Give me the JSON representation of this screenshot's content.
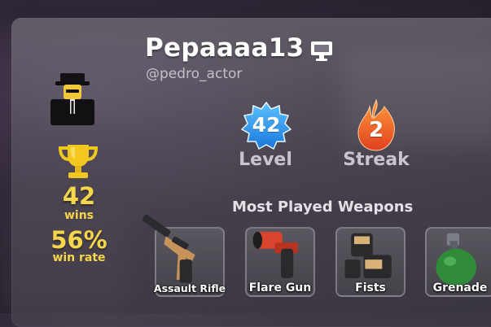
{
  "profile": {
    "display_name": "Pepaaaa13",
    "handle": "@pedro_actor",
    "platform_icon": "desktop-computer-icon",
    "avatar": "avatar-in-black-hat-and-suit"
  },
  "stats": {
    "wins_value": "42",
    "wins_label": "wins",
    "win_rate_value": "56%",
    "win_rate_label": "win rate",
    "trophy_icon": "trophy-icon",
    "level_value": "42",
    "level_label": "Level",
    "level_badge_icon": "blue-star-badge-icon",
    "streak_value": "2",
    "streak_label": "Streak",
    "streak_badge_icon": "flame-icon"
  },
  "weapons": {
    "title": "Most Played Weapons",
    "items": [
      {
        "name": "Assault Rifle",
        "icon": "assault-rifle-icon"
      },
      {
        "name": "Flare Gun",
        "icon": "flare-gun-icon"
      },
      {
        "name": "Fists",
        "icon": "fists-icon"
      },
      {
        "name": "Grenade",
        "icon": "grenade-icon"
      }
    ]
  },
  "colors": {
    "accent_gold": "#f6d64a",
    "level_blue": "#2f9af0",
    "streak_orange": "#f0602a"
  }
}
